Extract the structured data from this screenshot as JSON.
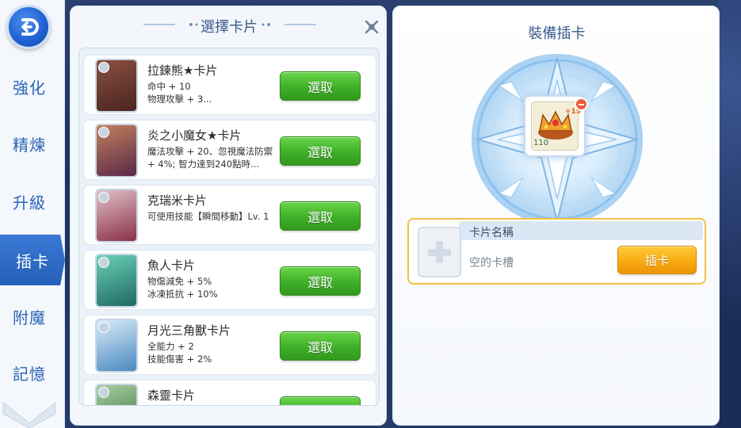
{
  "nav": {
    "items": [
      {
        "label": "強化",
        "active": false
      },
      {
        "label": "精煉",
        "active": false
      },
      {
        "label": "升級",
        "active": false
      },
      {
        "label": "插卡",
        "active": true
      },
      {
        "label": "附魔",
        "active": false
      },
      {
        "label": "記憶",
        "active": false
      }
    ],
    "back_icon": "back-arrow-icon",
    "scroll_icon": "chevron-down-icon"
  },
  "card_select": {
    "title": "選擇卡片",
    "close_icon": "close-icon",
    "cards": [
      {
        "name": "拉鍊熊★卡片",
        "desc": "命中 + 10\n物理攻擊 + 3...",
        "button": "選取",
        "thumb_color": "#6b3a2e"
      },
      {
        "name": "炎之小魔女★卡片",
        "desc": "魔法攻擊 + 20、忽視魔法防禦 + 4%; 智力達到240點時...",
        "button": "選取",
        "thumb_color": "#7a4a6e"
      },
      {
        "name": "克瑞米卡片",
        "desc": "可使用技能【瞬間移動】Lv. 1",
        "button": "選取",
        "thumb_color": "#8a4058"
      },
      {
        "name": "魚人卡片",
        "desc": "物傷減免 + 5%\n冰凍抵抗 + 10%",
        "button": "選取",
        "thumb_color": "#2a8a7a"
      },
      {
        "name": "月光三角獸卡片",
        "desc": "全能力 + 2\n技能傷害 + 2%",
        "button": "選取",
        "thumb_color": "#6aa8d8"
      },
      {
        "name": "森靈卡片",
        "desc": "",
        "button": "選取",
        "thumb_color": "#5a8a4a"
      }
    ]
  },
  "equip": {
    "title": "裝備插卡",
    "equipment": {
      "level": "110",
      "refine": "+15",
      "icon": "crown-equipment-icon"
    },
    "slot": {
      "header": "卡片名稱",
      "empty_text": "空的卡槽",
      "button": "插卡",
      "empty_icon": "plus-icon"
    }
  },
  "colors": {
    "accent_blue": "#2c64b8",
    "select_green": "#3fae28",
    "insert_orange": "#f7a80f",
    "slot_border": "#f3c042"
  }
}
